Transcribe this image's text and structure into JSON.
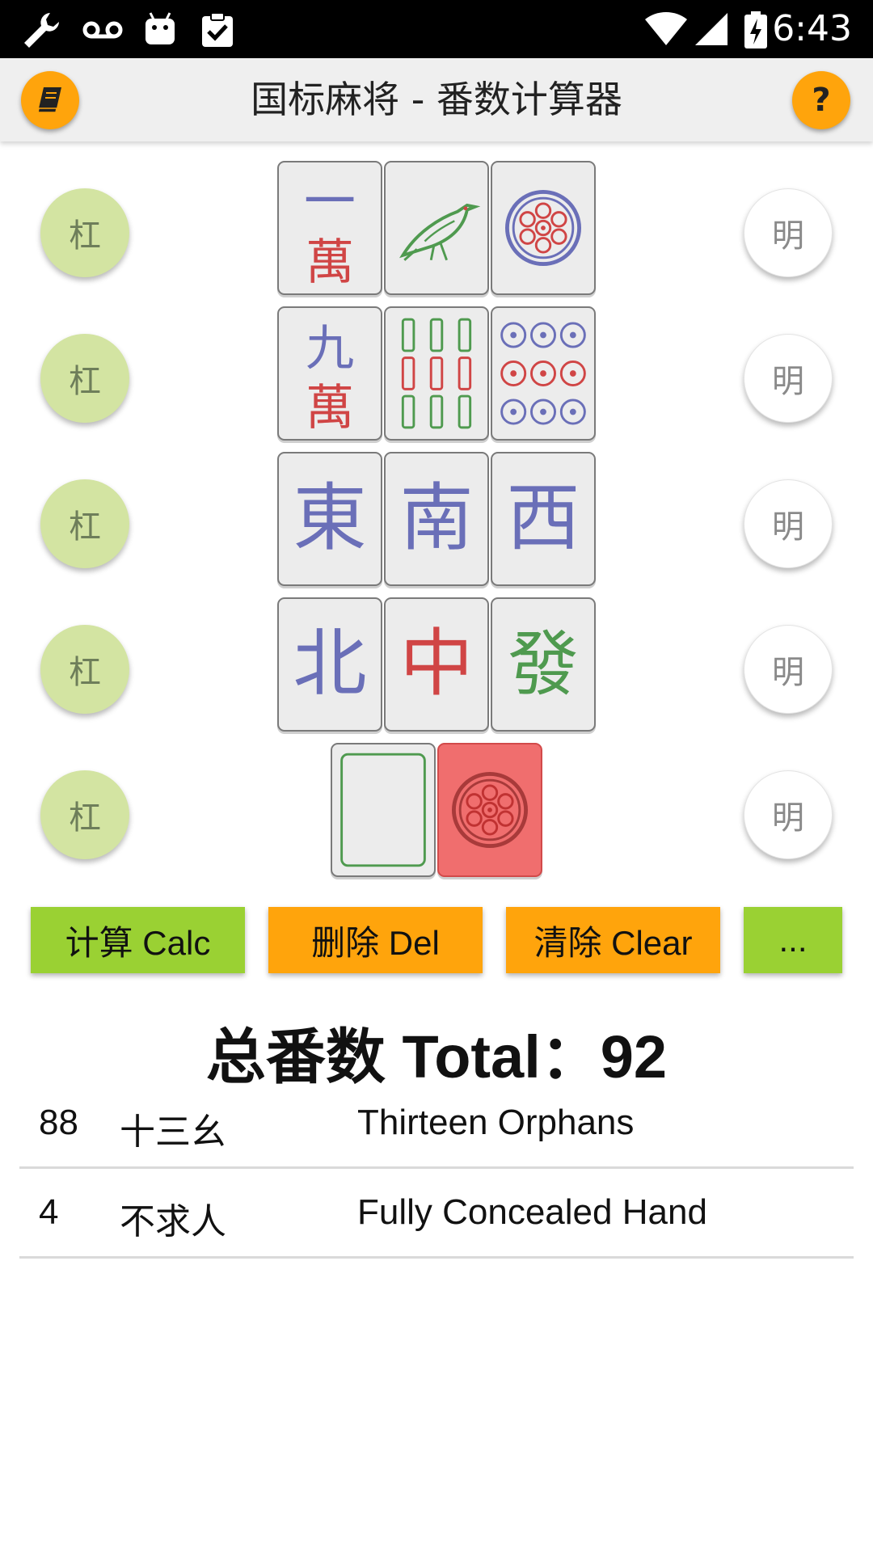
{
  "status_bar": {
    "time": "6:43",
    "icons": [
      "wrench-icon",
      "voicemail-icon",
      "android-icon",
      "clipboard-check-icon",
      "wifi-icon",
      "signal-icon",
      "battery-charging-icon"
    ]
  },
  "app_bar": {
    "title": "国标麻将 - 番数计算器",
    "left_button_icon": "book-icon",
    "help_label": "?",
    "accent_color": "#ffa40c"
  },
  "rows": [
    {
      "kong_label": "杠",
      "open_label": "明",
      "tiles": [
        {
          "id": "1-character",
          "top": "一",
          "bottom": "萬"
        },
        {
          "id": "1-bamboo",
          "icon": "bird-icon"
        },
        {
          "id": "1-circle",
          "icon": "circle-1-icon"
        }
      ]
    },
    {
      "kong_label": "杠",
      "open_label": "明",
      "tiles": [
        {
          "id": "9-character",
          "top": "九",
          "bottom": "萬"
        },
        {
          "id": "9-bamboo",
          "icon": "bamboo-9-icon"
        },
        {
          "id": "9-circle",
          "icon": "circle-9-icon"
        }
      ]
    },
    {
      "kong_label": "杠",
      "open_label": "明",
      "tiles": [
        {
          "id": "east-wind",
          "glyph": "東"
        },
        {
          "id": "south-wind",
          "glyph": "南"
        },
        {
          "id": "west-wind",
          "glyph": "西"
        }
      ]
    },
    {
      "kong_label": "杠",
      "open_label": "明",
      "tiles": [
        {
          "id": "north-wind",
          "glyph": "北"
        },
        {
          "id": "red-dragon",
          "glyph": "中"
        },
        {
          "id": "green-dragon",
          "glyph": "發"
        }
      ]
    },
    {
      "kong_label": "杠",
      "open_label": "明",
      "tiles": [
        {
          "id": "white-dragon",
          "icon": "blank-frame-icon"
        },
        {
          "id": "1-circle",
          "icon": "circle-1-icon",
          "selected": true
        }
      ]
    }
  ],
  "actions": {
    "calc": "计算 Calc",
    "del": "删除 Del",
    "clear": "清除 Clear",
    "more": "..."
  },
  "total": {
    "label": "总番数 Total：",
    "value": "92"
  },
  "results": [
    {
      "fan": "88",
      "name_zh": "十三幺",
      "name_en": "Thirteen Orphans"
    },
    {
      "fan": "4",
      "name_zh": "不求人",
      "name_en": "Fully Concealed Hand"
    }
  ],
  "colors": {
    "kong_bg": "#d3e4a2",
    "calc_bg": "#9ad133",
    "del_bg": "#ffa40c",
    "selected_tile": "#f06e6e",
    "tile_blue": "#6a6fb8",
    "tile_red": "#d04545",
    "tile_green": "#4f9a4f"
  }
}
